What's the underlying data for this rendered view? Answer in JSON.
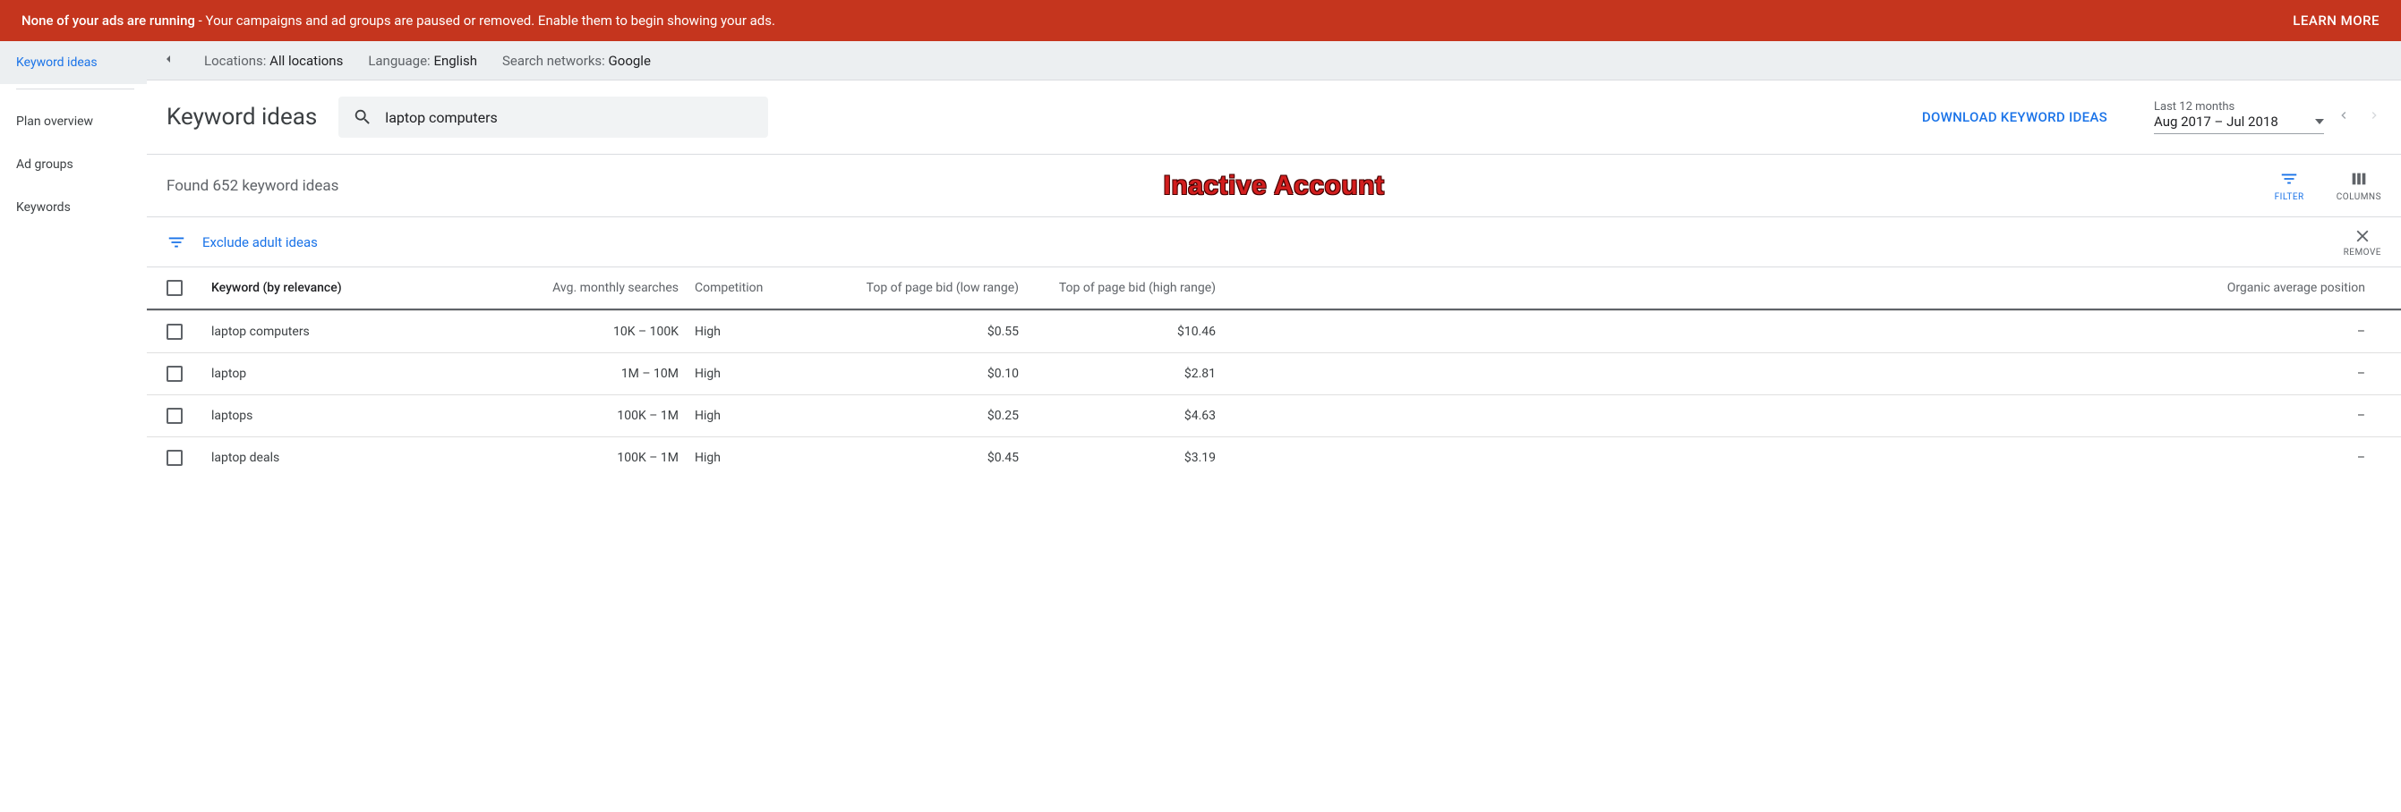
{
  "alert": {
    "bold": "None of your ads are running",
    "rest": " - Your campaigns and ad groups are paused or removed. Enable them to begin showing your ads.",
    "cta": "LEARN MORE"
  },
  "sidebar": {
    "items": [
      {
        "label": "Keyword ideas",
        "active": true
      },
      {
        "label": "Plan overview",
        "active": false
      },
      {
        "label": "Ad groups",
        "active": false
      },
      {
        "label": "Keywords",
        "active": false
      }
    ]
  },
  "settings": {
    "locations_label": "Locations:",
    "locations_value": "All locations",
    "language_label": "Language:",
    "language_value": "English",
    "networks_label": "Search networks:",
    "networks_value": "Google"
  },
  "header": {
    "title": "Keyword ideas",
    "search_value": "laptop computers",
    "download_label": "DOWNLOAD KEYWORD IDEAS",
    "date_label": "Last 12 months",
    "date_value": "Aug 2017 – Jul 2018"
  },
  "status": {
    "found_text": "Found 652 keyword ideas",
    "overlay": "Inactive Account",
    "filter_label": "FILTER",
    "columns_label": "COLUMNS"
  },
  "filter_chip": {
    "text": "Exclude adult ideas",
    "remove_label": "REMOVE"
  },
  "table": {
    "headers": {
      "keyword": "Keyword (by relevance)",
      "searches": "Avg. monthly searches",
      "competition": "Competition",
      "bid_low": "Top of page bid (low range)",
      "bid_high": "Top of page bid (high range)",
      "organic": "Organic average position"
    },
    "rows": [
      {
        "keyword": "laptop computers",
        "searches": "10K – 100K",
        "competition": "High",
        "bid_low": "$0.55",
        "bid_high": "$10.46",
        "organic": "–"
      },
      {
        "keyword": "laptop",
        "searches": "1M – 10M",
        "competition": "High",
        "bid_low": "$0.10",
        "bid_high": "$2.81",
        "organic": "–"
      },
      {
        "keyword": "laptops",
        "searches": "100K – 1M",
        "competition": "High",
        "bid_low": "$0.25",
        "bid_high": "$4.63",
        "organic": "–"
      },
      {
        "keyword": "laptop deals",
        "searches": "100K – 1M",
        "competition": "High",
        "bid_low": "$0.45",
        "bid_high": "$3.19",
        "organic": "–"
      }
    ]
  }
}
